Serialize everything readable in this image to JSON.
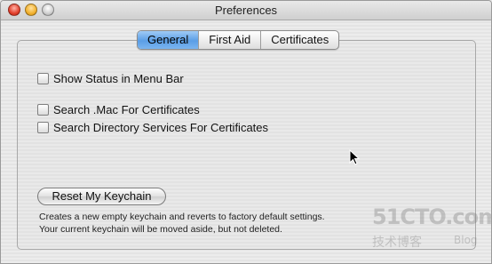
{
  "window": {
    "title": "Preferences"
  },
  "tabs": [
    {
      "label": "General",
      "active": true
    },
    {
      "label": "First Aid",
      "active": false
    },
    {
      "label": "Certificates",
      "active": false
    }
  ],
  "options": {
    "show_status": {
      "label": "Show Status in Menu Bar",
      "checked": false
    },
    "search_mac": {
      "label": "Search .Mac For Certificates",
      "checked": false
    },
    "search_directory": {
      "label": "Search Directory Services For Certificates",
      "checked": false
    }
  },
  "reset": {
    "button_label": "Reset My Keychain",
    "help_line1": "Creates a new empty keychain and reverts to factory default settings.",
    "help_line2": "Your current keychain will be moved aside, but not deleted."
  },
  "watermark": {
    "main": "51CTO.com",
    "sub": "技术博客",
    "blog": "Blog"
  },
  "colors": {
    "active_tab": "#5a9ee6",
    "close_button": "#e2402c",
    "minimize_button": "#f2b12e"
  }
}
